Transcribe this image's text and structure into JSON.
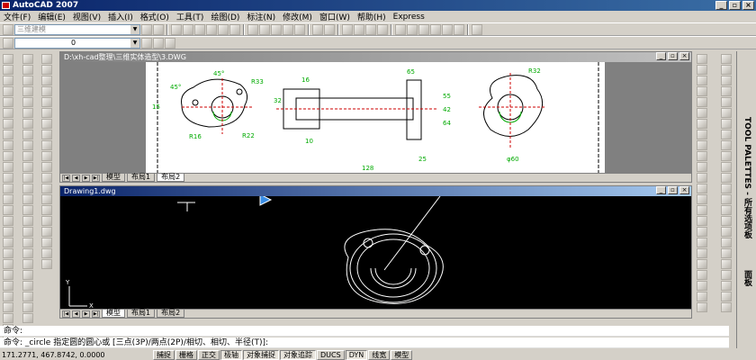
{
  "window": {
    "title": "AutoCAD 2007",
    "minimize": "_",
    "restore": "▫",
    "close": "×"
  },
  "menu": [
    "文件(F)",
    "编辑(E)",
    "视图(V)",
    "插入(I)",
    "格式(O)",
    "工具(T)",
    "绘图(D)",
    "标注(N)",
    "修改(M)",
    "窗口(W)",
    "帮助(H)",
    "Express"
  ],
  "toolbar": {
    "workspace_combo": "三维建模",
    "layer_combo": "0"
  },
  "drawing_window": {
    "title": "D:\\xh-cad整理\\三维实体造型\\3.DWG",
    "tabs": [
      "模型",
      "布局1",
      "布局2"
    ],
    "dims": {
      "a45a": "45°",
      "a45b": "45°",
      "r33": "R33",
      "r16": "R16",
      "r22": "R22",
      "d15": "15",
      "d16": "16",
      "d65": "65",
      "d32": "32",
      "d10": "10",
      "d42": "42",
      "d55": "55",
      "d64": "64",
      "d25": "25",
      "d128": "128",
      "r32": "R32",
      "d60": "φ60"
    }
  },
  "model_window": {
    "title": "Drawing1.dwg",
    "tabs": [
      "模型",
      "布局1",
      "布局2"
    ],
    "ucs_y": "Y",
    "ucs_x": "X"
  },
  "command": {
    "line1": "命令:",
    "line2": "命令: _circle 指定圆的圆心或 [三点(3P)/两点(2P)/相切、相切、半径(T)]:"
  },
  "status": {
    "coords": "171.2771, 467.8742, 0.0000",
    "buttons": [
      "捕捉",
      "栅格",
      "正交",
      "极轴",
      "对象捕捉",
      "对象追踪",
      "DUCS",
      "DYN",
      "线宽",
      "模型"
    ]
  },
  "palette": {
    "label": "TOOL PALETTES - 所有选项板",
    "label2": "面板"
  }
}
